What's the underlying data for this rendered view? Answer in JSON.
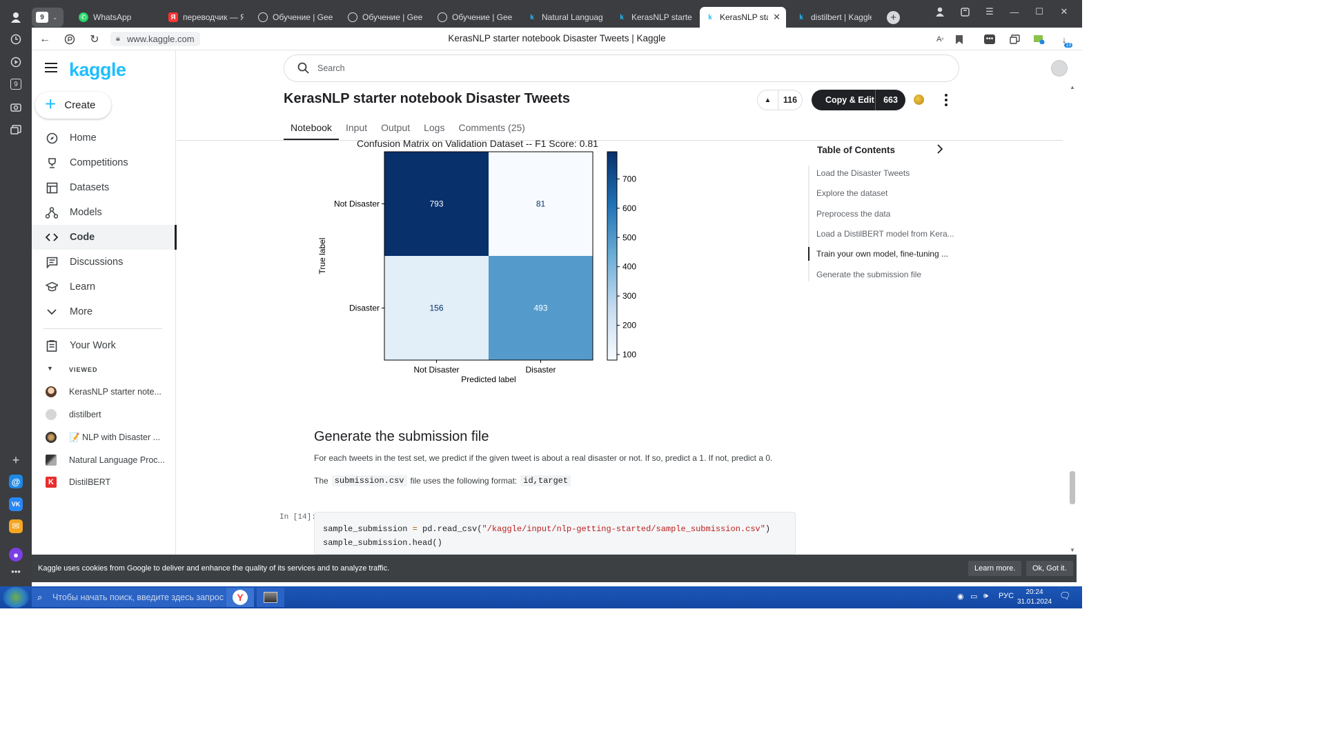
{
  "browser": {
    "tab_count_badge": "9",
    "tabs": [
      {
        "label": "WhatsApp"
      },
      {
        "label": "переводчик — Янд"
      },
      {
        "label": "Обучение | GeekBr"
      },
      {
        "label": "Обучение | GeekBr"
      },
      {
        "label": "Обучение | GeekBr"
      },
      {
        "label": "Natural Language P"
      },
      {
        "label": "KerasNLP starter no"
      },
      {
        "label": "KerasNLP starter"
      },
      {
        "label": "distilbert | Kaggle"
      }
    ],
    "url": "www.kaggle.com",
    "page_title": "KerasNLP starter notebook Disaster Tweets | Kaggle",
    "rail_badge": "9",
    "download_badge": "13"
  },
  "sidebar": {
    "logo": "kaggle",
    "create_label": "Create",
    "nav": [
      {
        "label": "Home",
        "icon": "compass-icon"
      },
      {
        "label": "Competitions",
        "icon": "trophy-icon"
      },
      {
        "label": "Datasets",
        "icon": "table-icon"
      },
      {
        "label": "Models",
        "icon": "models-icon"
      },
      {
        "label": "Code",
        "icon": "code-icon"
      },
      {
        "label": "Discussions",
        "icon": "discussion-icon"
      },
      {
        "label": "Learn",
        "icon": "learn-icon"
      },
      {
        "label": "More",
        "icon": "chevron-down-icon"
      }
    ],
    "your_work": "Your Work",
    "viewed_heading": "VIEWED",
    "viewed": [
      {
        "label": "KerasNLP starter note..."
      },
      {
        "label": "distilbert"
      },
      {
        "label": "📝 NLP with Disaster ..."
      },
      {
        "label": "Natural Language Proc..."
      },
      {
        "label": "DistilBERT"
      }
    ]
  },
  "header": {
    "search_placeholder": "Search",
    "title": "KerasNLP starter notebook Disaster Tweets",
    "votes": "116",
    "copy_edit_label": "Copy & Edit",
    "copy_edit_count": "663",
    "tabs": [
      "Notebook",
      "Input",
      "Output",
      "Logs",
      "Comments (25)"
    ]
  },
  "toc": {
    "heading": "Table of Contents",
    "items": [
      "Load the Disaster Tweets",
      "Explore the dataset",
      "Preprocess the data",
      "Load a DistilBERT model from Kera...",
      "Train your own model, fine-tuning ...",
      "Generate the submission file"
    ]
  },
  "chart_data": {
    "type": "heatmap",
    "title": "Confusion Matrix on Validation Dataset -- F1 Score: 0.81",
    "xlabel": "Predicted label",
    "ylabel": "True label",
    "x_categories": [
      "Not Disaster",
      "Disaster"
    ],
    "y_categories": [
      "Not Disaster",
      "Disaster"
    ],
    "values": [
      [
        793,
        81
      ],
      [
        156,
        493
      ]
    ],
    "colorbar_ticks": [
      100,
      200,
      300,
      400,
      500,
      600,
      700
    ],
    "colorbar_range": [
      81,
      793
    ],
    "colormap": "Blues"
  },
  "content": {
    "section_title": "Generate the submission file",
    "para1": "For each tweets in the test set, we predict if the given tweet is about a real disaster or not. If so, predict a 1. If not, predict a 0.",
    "para2_prefix": "The",
    "para2_code1": "submission.csv",
    "para2_mid": "file uses the following format:",
    "para2_code2": "id,target",
    "cell_label": "In [14]:",
    "code_line1_var": "sample_submission",
    "code_line1_op": "=",
    "code_line1_call": "pd.read_csv(",
    "code_line1_str": "\"/kaggle/input/nlp-getting-started/sample_submission.csv\"",
    "code_line1_end": ")",
    "code_line2": "sample_submission.head()"
  },
  "cookie": {
    "text": "Kaggle uses cookies from Google to deliver and enhance the quality of its services and to analyze traffic.",
    "learn_more": "Learn more.",
    "ok": "Ok, Got it."
  },
  "taskbar": {
    "search_placeholder": "Чтобы начать поиск, введите здесь запрос",
    "lang": "РУС",
    "time": "20:24",
    "date": "31.01.2024"
  }
}
